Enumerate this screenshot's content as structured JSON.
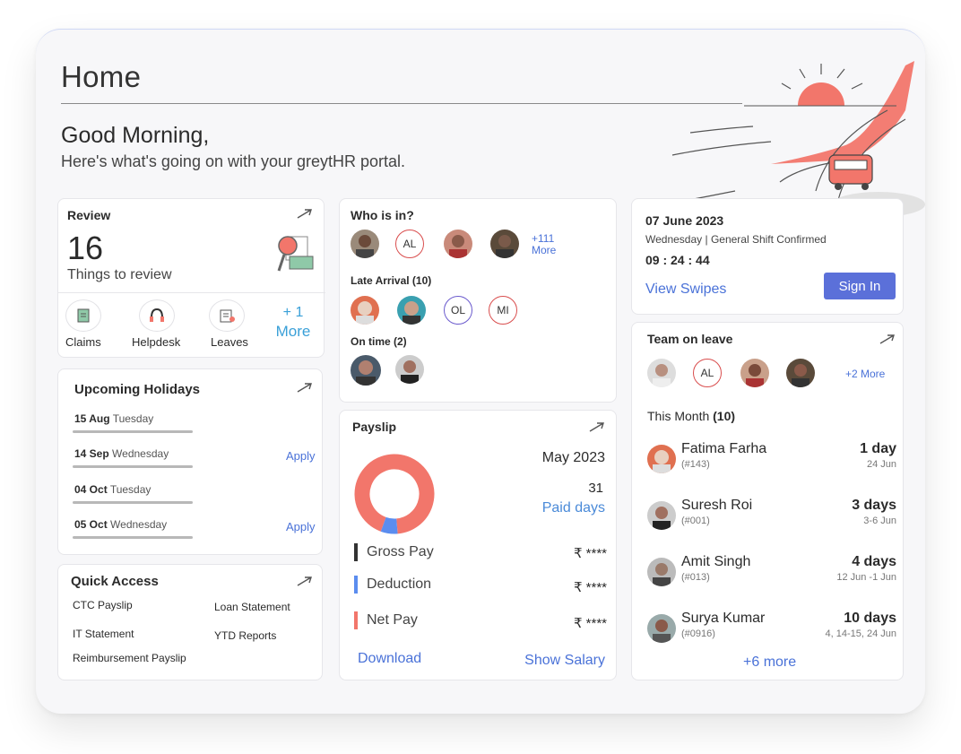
{
  "page": {
    "title": "Home",
    "greeting": "Good Morning,",
    "subtitle": "Here's what's going on with your greytHR portal."
  },
  "review": {
    "title": "Review",
    "count": "16",
    "caption": "Things to review",
    "actions": [
      {
        "label": "Claims",
        "icon": "claims-icon"
      },
      {
        "label": "Helpdesk",
        "icon": "headset-icon"
      },
      {
        "label": "Leaves",
        "icon": "leaves-icon"
      }
    ],
    "more_count": "+ 1",
    "more_label": "More"
  },
  "holidays": {
    "title": "Upcoming Holidays",
    "items": [
      {
        "date": "15 Aug",
        "day": "Tuesday",
        "action": ""
      },
      {
        "date": "14 Sep",
        "day": "Wednesday",
        "action": "Apply"
      },
      {
        "date": "04 Oct",
        "day": "Tuesday",
        "action": ""
      },
      {
        "date": "05 Oct",
        "day": "Wednesday",
        "action": "Apply"
      }
    ]
  },
  "quick_access": {
    "title": "Quick Access",
    "links": [
      "CTC Payslip",
      "Loan Statement",
      "IT Statement",
      "YTD Reports",
      "Reimbursement Payslip"
    ]
  },
  "who_is_in": {
    "title": "Who is in?",
    "more_count": "+111",
    "more_label": "More",
    "initials": [
      "AL",
      "OL",
      "MI"
    ],
    "late_label": "Late Arrival (10)",
    "ontime_label": "On time (2)"
  },
  "payslip": {
    "title": "Payslip",
    "month": "May 2023",
    "paid_days": "31",
    "paid_label": "Paid days",
    "rows": [
      {
        "label": "Gross Pay",
        "value": "₹ ****",
        "color": "#333333"
      },
      {
        "label": "Deduction",
        "value": "₹ ****",
        "color": "#5b8def"
      },
      {
        "label": "Net Pay",
        "value": "₹ ****",
        "color": "#f2766b"
      }
    ],
    "donut": {
      "net_share": 0.93,
      "deduction_share": 0.07,
      "net_color": "#f2766b",
      "deduction_color": "#5b8def"
    },
    "download": "Download",
    "show_salary": "Show Salary"
  },
  "attendance": {
    "date": "07 June 2023",
    "shift": "Wednesday | General Shift Confirmed",
    "time": "09 : 24 : 44",
    "view_swipes": "View Swipes",
    "sign_in": "Sign In"
  },
  "team_leave": {
    "title": "Team on leave",
    "initials": "AL",
    "more": "+2 More",
    "month_label": "This Month",
    "month_count": "(10)",
    "people": [
      {
        "name": "Fatima Farha",
        "id": "(#143)",
        "days": "1 day",
        "dates": "24 Jun"
      },
      {
        "name": "Suresh Roi",
        "id": "(#001)",
        "days": "3 days",
        "dates": "3-6 Jun"
      },
      {
        "name": "Amit Singh",
        "id": "(#013)",
        "days": "4 days",
        "dates": "12 Jun -1 Jun"
      },
      {
        "name": "Surya Kumar",
        "id": "(#0916)",
        "days": "10 days",
        "dates": "4, 14-15, 24 Jun"
      }
    ],
    "more_link": "+6 more"
  },
  "colors": {
    "accent": "#5b70d9",
    "link": "#4a72d8",
    "salmon": "#f2766b"
  }
}
